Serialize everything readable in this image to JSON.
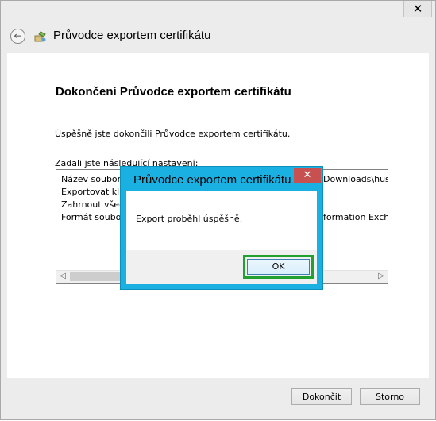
{
  "window": {
    "close_glyph": "✕",
    "title": "Průvodce exportem certifikátu",
    "back_icon": "back-arrow-icon",
    "wizard_icon": "certificate-wizard-icon"
  },
  "page": {
    "heading": "Dokončení Průvodce exportem certifikátu",
    "done_text": "Úspěšně jste dokončili Průvodce exportem certifikátu.",
    "settings_label": "Zadali jste následující nastavení:",
    "settings": [
      {
        "key": "Název souboru",
        "value": "Downloads\\husa-"
      },
      {
        "key": "Exportovat klíče",
        "value": ""
      },
      {
        "key": "Zahrnout všechny",
        "value": ""
      },
      {
        "key": "Formát souboru",
        "value": "formation Excha"
      }
    ]
  },
  "footer": {
    "finish_label": "Dokončit",
    "cancel_label": "Storno"
  },
  "message_box": {
    "title": "Průvodce exportem certifikátu",
    "close_glyph": "✕",
    "text": "Export proběhl úspěšně.",
    "ok_label": "OK"
  },
  "colors": {
    "msgbox_border": "#1ab0e2",
    "close_red": "#c75050",
    "ok_highlight": "#21a12f"
  }
}
